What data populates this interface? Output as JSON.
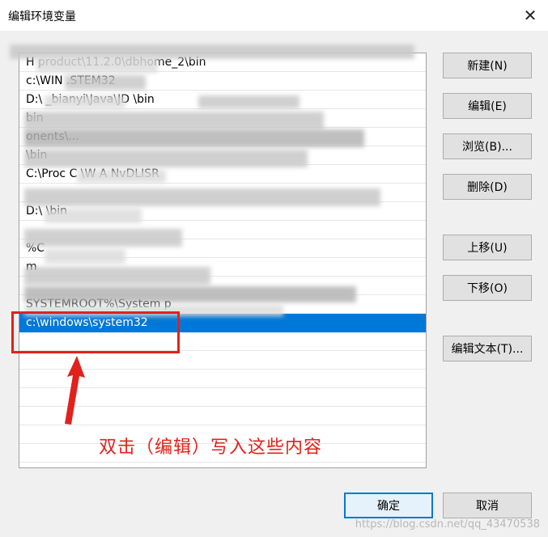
{
  "dialog": {
    "title": "编辑环境变量",
    "close_glyph": "✕"
  },
  "list": {
    "items": [
      {
        "text": "H                          product\\11.2.0\\dbhome_2\\bin"
      },
      {
        "text": "c:\\WIN                     .STEM32"
      },
      {
        "text": "D:\\                  _bianyi\\Java\\JD                 \\bin"
      },
      {
        "text": "                                                        bin"
      },
      {
        "text": "                                                                     onents\\..."
      },
      {
        "text": "                                         \\bin"
      },
      {
        "text": "C:\\Proc                          C            \\W          A NvDLISR"
      },
      {
        "text": ""
      },
      {
        "text": "D:\\                         \\bin"
      },
      {
        "text": ""
      },
      {
        "text": "%C"
      },
      {
        "text": "                                               m"
      },
      {
        "text": ""
      },
      {
        "text": "  SYSTEMROOT%\\System                 p"
      },
      {
        "text": "c:\\windows\\system32",
        "selected": true
      },
      {
        "text": ""
      },
      {
        "text": ""
      },
      {
        "text": ""
      },
      {
        "text": ""
      },
      {
        "text": ""
      },
      {
        "text": ""
      },
      {
        "text": ""
      }
    ]
  },
  "buttons": {
    "new": "新建(N)",
    "edit": "编辑(E)",
    "browse": "浏览(B)...",
    "delete": "删除(D)",
    "move_up": "上移(U)",
    "move_down": "下移(O)",
    "edit_text": "编辑文本(T)...",
    "ok": "确定",
    "cancel": "取消"
  },
  "annotation": {
    "text": "双击（编辑）写入这些内容",
    "color": "#e2211c"
  },
  "watermark": "https://blog.csdn.net/qq_43470538",
  "colors": {
    "selection": "#0078d7",
    "primary_border": "#0078d7"
  }
}
